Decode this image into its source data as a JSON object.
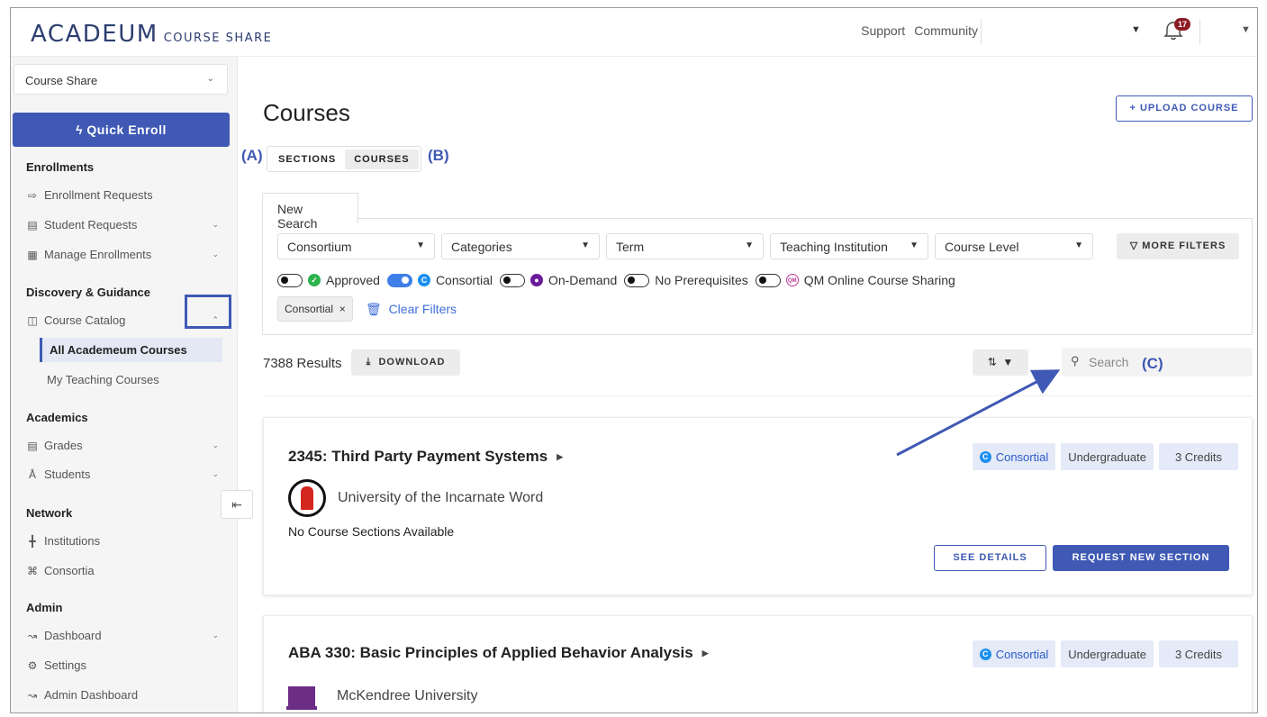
{
  "header": {
    "logo_main": "ACADEUM",
    "logo_sub": "COURSE SHARE",
    "links": [
      "Support",
      "Community"
    ],
    "notification_count": "17"
  },
  "sidebar": {
    "app_selector": "Course Share",
    "quick_enroll": "ϟ Quick Enroll",
    "sections": {
      "enrollments": "Enrollments",
      "discovery": "Discovery & Guidance",
      "academics": "Academics",
      "network": "Network",
      "admin": "Admin"
    },
    "items": {
      "enrollment_requests": "Enrollment Requests",
      "student_requests": "Student Requests",
      "manage_enrollments": "Manage Enrollments",
      "course_catalog": "Course Catalog",
      "all_academeum_courses": "All Academeum Courses",
      "my_teaching_courses": "My Teaching Courses",
      "grades": "Grades",
      "students": "Students",
      "institutions": "Institutions",
      "consortia": "Consortia",
      "dashboard": "Dashboard",
      "settings": "Settings",
      "admin_dashboard": "Admin Dashboard"
    }
  },
  "main": {
    "title": "Courses",
    "upload_button": "+ UPLOAD COURSE",
    "view_toggle": {
      "sections": "SECTIONS",
      "courses": "COURSES",
      "selected": "COURSES"
    },
    "annotations": {
      "a": "(A)",
      "b": "(B)",
      "c": "(C)"
    },
    "search_tab": "New Search",
    "filters": {
      "dropdowns": [
        "Consortium",
        "Categories",
        "Term",
        "Teaching Institution",
        "Course Level"
      ],
      "more_filters": "MORE FILTERS",
      "toggles": [
        {
          "label": "Approved",
          "on": false
        },
        {
          "label": "Consortial",
          "on": true
        },
        {
          "label": "On-Demand",
          "on": false
        },
        {
          "label": "No Prerequisites",
          "on": false
        },
        {
          "label": "QM Online Course Sharing",
          "on": false
        }
      ],
      "active_chip": "Consortial",
      "clear_filters": "Clear Filters"
    },
    "results": "7388 Results",
    "download_button": "DOWNLOAD",
    "search_placeholder": "Search",
    "courses": [
      {
        "title": "2345: Third Party Payment Systems",
        "institution": "University of the Incarnate Word",
        "badges": [
          "Consortial",
          "Undergraduate",
          "3 Credits"
        ],
        "sections_note": "No Course Sections Available",
        "see_details": "SEE DETAILS",
        "request_section": "REQUEST NEW SECTION"
      },
      {
        "title": "ABA 330: Basic Principles of Applied Behavior Analysis",
        "institution": "McKendree University",
        "badges": [
          "Consortial",
          "Undergraduate",
          "3 Credits"
        ]
      }
    ]
  },
  "colors": {
    "brand": "#3f59b4",
    "logo": "#2d3e70",
    "toggle_on": "#3f7fe8",
    "approved": "#2bb34b",
    "on_demand": "#6a1b9a",
    "badge_bg": "#e4eaf7"
  }
}
